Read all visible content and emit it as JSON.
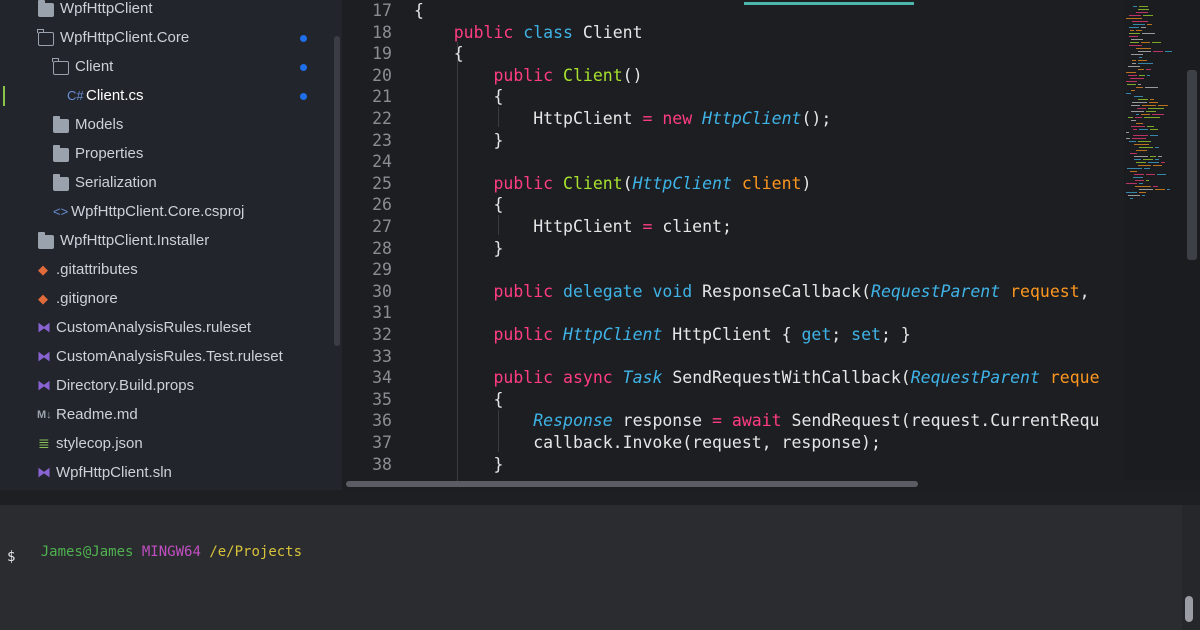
{
  "explorer": {
    "items": [
      {
        "label": "WpfHttpClient",
        "icon": "folder-icon"
      },
      {
        "label": "WpfHttpClient.Core",
        "icon": "folder-open-icon",
        "modified": true
      },
      {
        "label": "Client",
        "icon": "folder-open-icon",
        "modified": true
      },
      {
        "label": "Client.cs",
        "icon": "csharp-file-icon",
        "icon_text": "C#",
        "modified": true,
        "active": true
      },
      {
        "label": "Models",
        "icon": "folder-icon"
      },
      {
        "label": "Properties",
        "icon": "folder-icon"
      },
      {
        "label": "Serialization",
        "icon": "folder-icon"
      },
      {
        "label": "WpfHttpClient.Core.csproj",
        "icon": "csproj-icon"
      },
      {
        "label": "WpfHttpClient.Installer",
        "icon": "folder-icon"
      },
      {
        "label": ".gitattributes",
        "icon": "git-icon"
      },
      {
        "label": ".gitignore",
        "icon": "git-icon"
      },
      {
        "label": "CustomAnalysisRules.ruleset",
        "icon": "visual-studio-icon"
      },
      {
        "label": "CustomAnalysisRules.Test.ruleset",
        "icon": "visual-studio-icon"
      },
      {
        "label": "Directory.Build.props",
        "icon": "visual-studio-icon"
      },
      {
        "label": "Readme.md",
        "icon": "markdown-icon"
      },
      {
        "label": "stylecop.json",
        "icon": "json-icon"
      },
      {
        "label": "WpfHttpClient.sln",
        "icon": "visual-studio-icon"
      }
    ]
  },
  "editor": {
    "lines": [
      {
        "n": "17",
        "code": "{"
      },
      {
        "n": "18",
        "code": "    public class Client"
      },
      {
        "n": "19",
        "code": "    {"
      },
      {
        "n": "20",
        "code": "        public Client()"
      },
      {
        "n": "21",
        "code": "        {"
      },
      {
        "n": "22",
        "code": "            HttpClient = new HttpClient();"
      },
      {
        "n": "23",
        "code": "        }"
      },
      {
        "n": "24",
        "code": ""
      },
      {
        "n": "25",
        "code": "        public Client(HttpClient client)"
      },
      {
        "n": "26",
        "code": "        {"
      },
      {
        "n": "27",
        "code": "            HttpClient = client;"
      },
      {
        "n": "28",
        "code": "        }"
      },
      {
        "n": "29",
        "code": ""
      },
      {
        "n": "30",
        "code": "        public delegate void ResponseCallback(RequestParent request,"
      },
      {
        "n": "31",
        "code": ""
      },
      {
        "n": "32",
        "code": "        public HttpClient HttpClient { get; set; }"
      },
      {
        "n": "33",
        "code": ""
      },
      {
        "n": "34",
        "code": "        public async Task SendRequestWithCallback(RequestParent reque"
      },
      {
        "n": "35",
        "code": "        {"
      },
      {
        "n": "36",
        "code": "            Response response = await SendRequest(request.CurrentRequ"
      },
      {
        "n": "37",
        "code": "            callback.Invoke(request, response);"
      },
      {
        "n": "38",
        "code": "        }"
      }
    ]
  },
  "terminal": {
    "user": "James@James",
    "shell": "MINGW64",
    "path": "/e/Projects",
    "prompt": "$"
  },
  "colors": {
    "keyword": "#ff3d7f",
    "type": "#3fb3e6",
    "function": "#a6e22e",
    "parameter": "#fd971f",
    "modified_dot": "#1f6feb",
    "terminal_user": "#4fb14f",
    "terminal_shell": "#c14fc1",
    "terminal_path": "#d7c23a"
  }
}
